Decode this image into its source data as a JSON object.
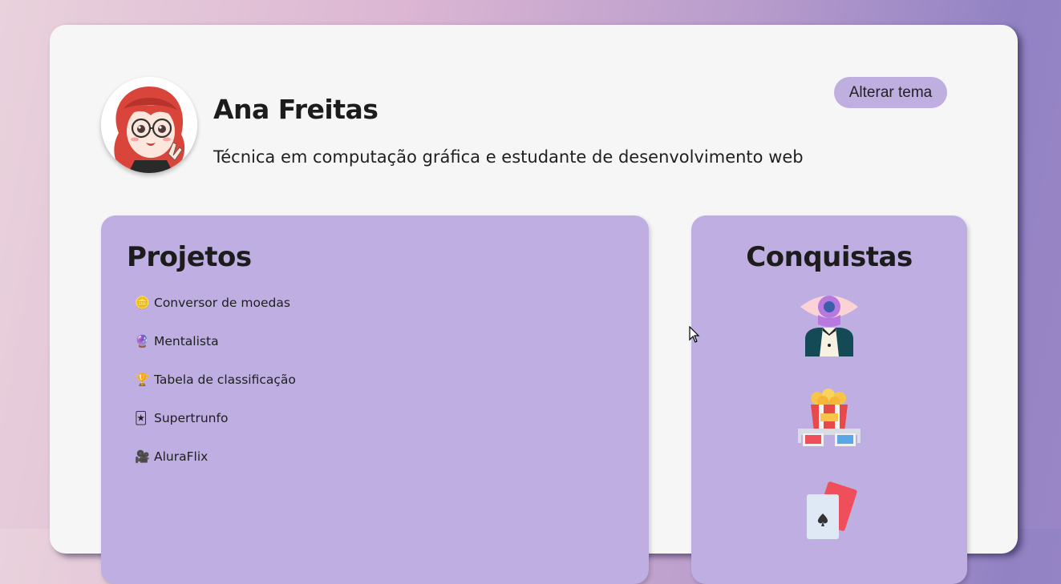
{
  "profile": {
    "name": "Ana Freitas",
    "bio": "Técnica em computação gráfica e estudante de desenvolvimento web"
  },
  "theme_button": {
    "label": "Alterar tema"
  },
  "projects": {
    "title": "Projetos",
    "items": [
      {
        "emoji": "🪙",
        "label": "Conversor de moedas"
      },
      {
        "emoji": "🔮",
        "label": "Mentalista"
      },
      {
        "emoji": "🏆",
        "label": "Tabela de classificação"
      },
      {
        "emoji": "🃏",
        "label": "Supertrunfo"
      },
      {
        "emoji": "🎥",
        "label": "AluraFlix"
      }
    ]
  },
  "achievements": {
    "title": "Conquistas",
    "badges": [
      "mentalist-icon",
      "popcorn-3d-glasses-icon",
      "playing-cards-icon"
    ]
  },
  "colors": {
    "panel": "#bfaee2",
    "button": "#bfaee0",
    "card": "#f6f6f6"
  }
}
